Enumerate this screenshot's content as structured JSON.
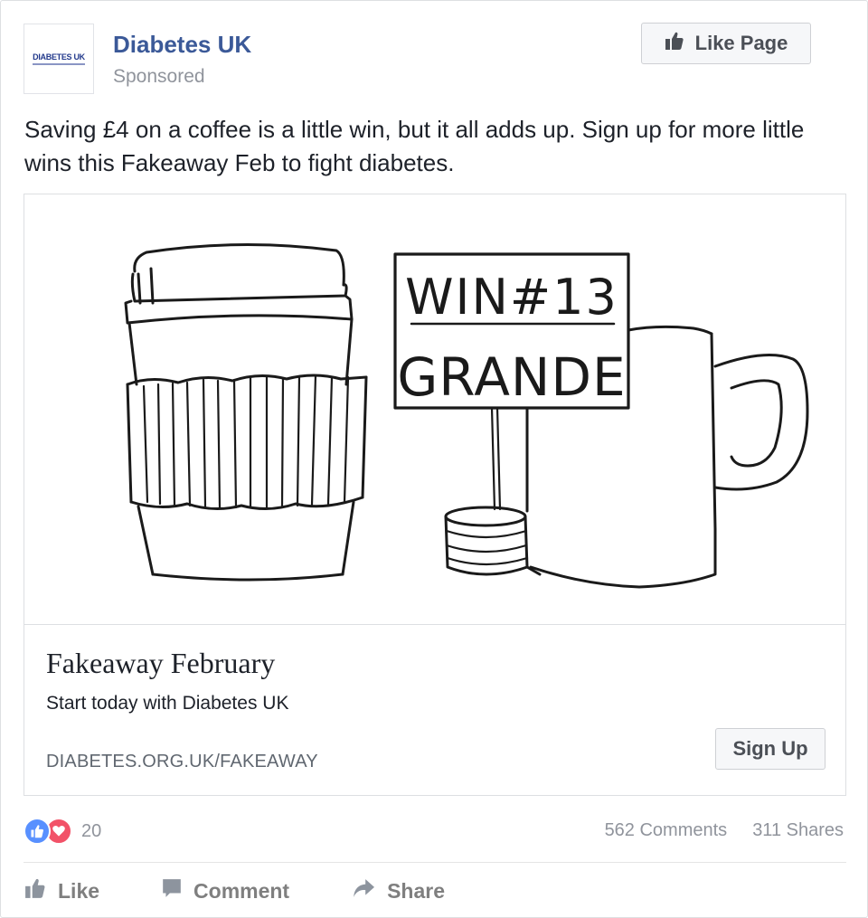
{
  "post": {
    "page_name": "Diabetes UK",
    "sponsored_label": "Sponsored",
    "avatar_text": "DIABETES UK",
    "like_page_label": "Like Page",
    "text": "Saving £4 on a coffee is a little win, but it all adds up. Sign up for more little wins this Fakeaway Feb to fight diabetes."
  },
  "attachment": {
    "sign_line1": "WIN#13",
    "sign_line2": "GRANDE",
    "title": "Fakeaway February",
    "description": "Start today with Diabetes UK",
    "domain": "DIABETES.ORG.UK/FAKEAWAY",
    "cta_label": "Sign Up"
  },
  "engagement": {
    "reaction_count": "20",
    "comments": "562 Comments",
    "shares": "311 Shares"
  },
  "actions": {
    "like": "Like",
    "comment": "Comment",
    "share": "Share"
  },
  "icons": {
    "like_page": "thumbs-up-icon",
    "reaction_like": "like-reaction-icon",
    "reaction_love": "love-reaction-icon",
    "action_like": "thumbs-up-icon",
    "action_comment": "comment-icon",
    "action_share": "share-arrow-icon"
  },
  "colors": {
    "brand_blue": "#3b5998",
    "reaction_like": "#5890ff",
    "reaction_love": "#f25268"
  }
}
